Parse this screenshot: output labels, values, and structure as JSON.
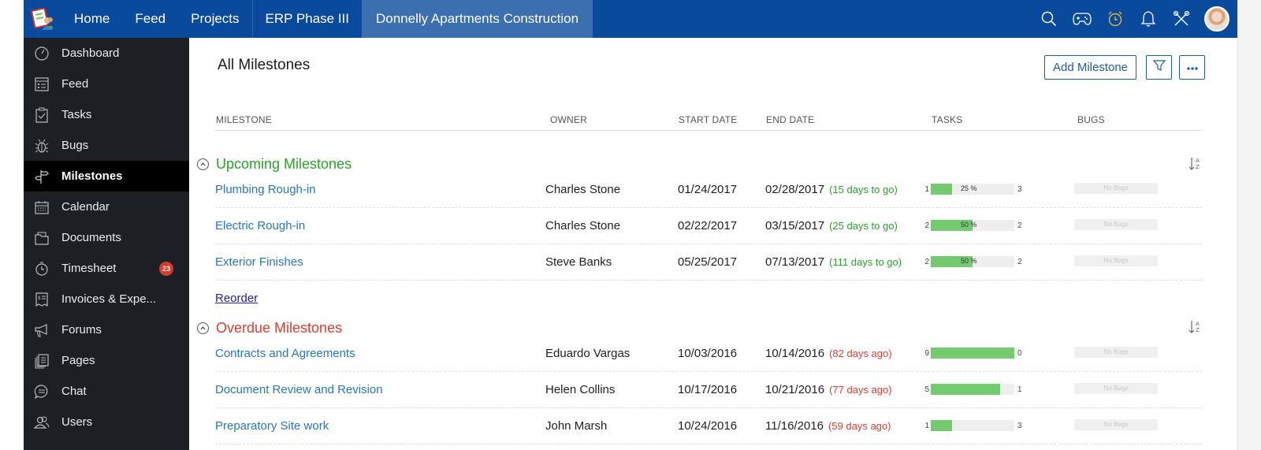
{
  "topbar": {
    "nav": [
      "Home",
      "Feed",
      "Projects",
      "ERP Phase III",
      "Donnelly Apartments Construction"
    ],
    "icons": [
      "search-icon",
      "gamepad-icon",
      "alarm-clock-icon",
      "bell-icon",
      "tools-icon"
    ],
    "accent": "#0a4a9c",
    "alarm_color": "#e0b43a"
  },
  "sidebar": {
    "items": [
      {
        "label": "Dashboard",
        "icon": "speedometer-icon"
      },
      {
        "label": "Feed",
        "icon": "feed-icon"
      },
      {
        "label": "Tasks",
        "icon": "clipboard-check-icon"
      },
      {
        "label": "Bugs",
        "icon": "bug-icon"
      },
      {
        "label": "Milestones",
        "icon": "signpost-icon",
        "active": true
      },
      {
        "label": "Calendar",
        "icon": "calendar-icon"
      },
      {
        "label": "Documents",
        "icon": "folder-icon"
      },
      {
        "label": "Timesheet",
        "icon": "stopwatch-icon",
        "badge": "23"
      },
      {
        "label": "Invoices & Expe...",
        "icon": "invoice-icon"
      },
      {
        "label": "Forums",
        "icon": "megaphone-icon"
      },
      {
        "label": "Pages",
        "icon": "pages-icon"
      },
      {
        "label": "Chat",
        "icon": "chat-icon"
      },
      {
        "label": "Users",
        "icon": "users-icon"
      }
    ]
  },
  "main": {
    "title": "All Milestones",
    "add_button": "Add Milestone",
    "columns": [
      "MILESTONE",
      "OWNER",
      "START DATE",
      "END DATE",
      "TASKS",
      "BUGS"
    ],
    "reorder_label": "Reorder",
    "groups": [
      {
        "title": "Upcoming Milestones",
        "color": "#2aa32a",
        "rows": [
          {
            "name": "Plumbing Rough-in",
            "owner": "Charles Stone",
            "start": "01/24/2017",
            "end": "02/28/2017",
            "relative": "(15 days to go)",
            "tasks_open": "1",
            "tasks_closed": "3",
            "progress": 25,
            "progress_label": "25 %",
            "bugs": "No Bugs"
          },
          {
            "name": "Electric Rough-in",
            "owner": "Charles Stone",
            "start": "02/22/2017",
            "end": "03/15/2017",
            "relative": "(25 days to go)",
            "tasks_open": "2",
            "tasks_closed": "2",
            "progress": 50,
            "progress_label": "50 %",
            "bugs": "No Bugs"
          },
          {
            "name": "Exterior Finishes",
            "owner": "Steve Banks",
            "start": "05/25/2017",
            "end": "07/13/2017",
            "relative": "(111 days to go)",
            "tasks_open": "2",
            "tasks_closed": "2",
            "progress": 50,
            "progress_label": "50 %",
            "bugs": "No Bugs"
          }
        ]
      },
      {
        "title": "Overdue Milestones",
        "color": "#d9402f",
        "rows": [
          {
            "name": "Contracts and Agreements",
            "owner": "Eduardo Vargas",
            "start": "10/03/2016",
            "end": "10/14/2016",
            "relative": "(82 days ago)",
            "tasks_open": "9",
            "tasks_closed": "0",
            "progress": 100,
            "progress_label": "",
            "bugs": "No Bugs"
          },
          {
            "name": "Document Review and Revision",
            "owner": "Helen Collins",
            "start": "10/17/2016",
            "end": "10/21/2016",
            "relative": "(77 days ago)",
            "tasks_open": "5",
            "tasks_closed": "1",
            "progress": 83,
            "progress_label": "",
            "bugs": "No Bugs"
          },
          {
            "name": "Preparatory Site work",
            "owner": "John Marsh",
            "start": "10/24/2016",
            "end": "11/16/2016",
            "relative": "(59 days ago)",
            "tasks_open": "1",
            "tasks_closed": "3",
            "progress": 25,
            "progress_label": "",
            "bugs": "No Bugs"
          }
        ]
      }
    ]
  }
}
